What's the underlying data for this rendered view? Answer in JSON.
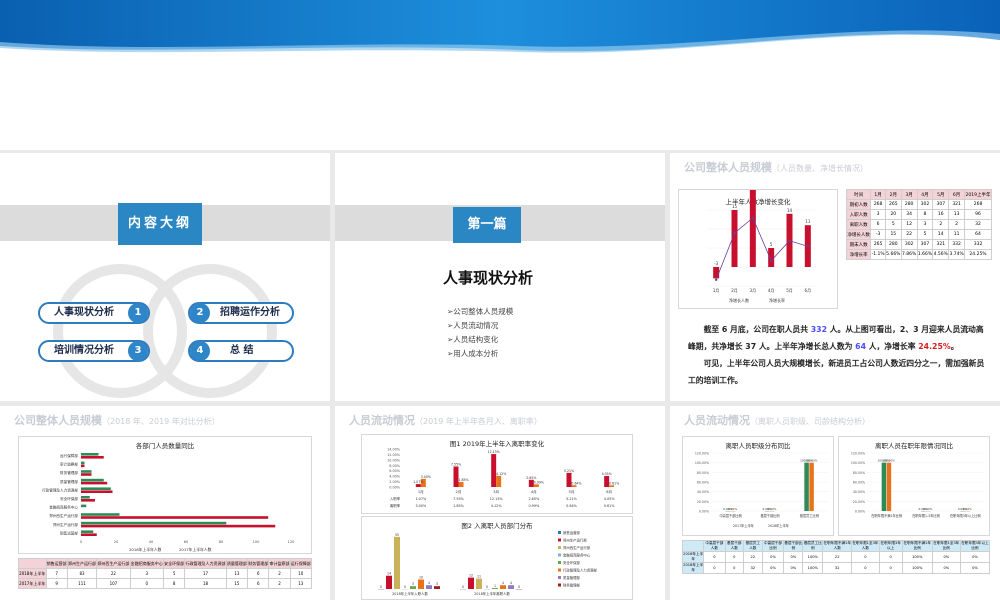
{
  "slide1": {
    "header": "内容大纲",
    "items": [
      {
        "label": "人事现状分析",
        "num": "1"
      },
      {
        "label": "招聘运作分析",
        "num": "2"
      },
      {
        "label": "培训情况分析",
        "num": "3"
      },
      {
        "label": "总  结",
        "num": "4"
      }
    ]
  },
  "slide2": {
    "tab": "第一篇",
    "title": "人事现状分析",
    "bullets": [
      "➢公司整体人员规模",
      "➢人员流动情况",
      "➢人员结构变化",
      "➢用人成本分析"
    ]
  },
  "slide3": {
    "title": "公司整体人员规模",
    "subtitle": "（人员数量、净增长情况）",
    "chart_title": "上半年人数净增长变化",
    "legend": [
      "净增长人数",
      "净增长率"
    ],
    "months": [
      "1月",
      "2月",
      "3月",
      "4月",
      "5月",
      "6月"
    ],
    "table_header": [
      "时间",
      "1月",
      "2月",
      "3月",
      "4月",
      "5月",
      "6月",
      "2019上半年"
    ],
    "table_rows": [
      [
        "期初人数",
        "268",
        "265",
        "280",
        "302",
        "307",
        "321",
        "268"
      ],
      [
        "入职人数",
        "3",
        "20",
        "34",
        "8",
        "16",
        "13",
        "96"
      ],
      [
        "离职人数",
        "6",
        "5",
        "12",
        "3",
        "2",
        "2",
        "32"
      ],
      [
        "净增长人数",
        "-3",
        "15",
        "22",
        "5",
        "14",
        "11",
        "64"
      ],
      [
        "期末人数",
        "265",
        "280",
        "302",
        "307",
        "321",
        "332",
        "332"
      ],
      [
        "净增长率",
        "-1.1%",
        "5.66%",
        "7.86%",
        "1.66%",
        "4.56%",
        "3.74%",
        "24.25%"
      ]
    ],
    "para1_a": "截至 6 月底，公司在职人员共 ",
    "para1_b": "332",
    "para1_c": " 人。从上图可看出，2、3 月迎来人员流动高峰期，共净增长 37 人。上半年净增长总人数为 ",
    "para1_d": "64",
    "para1_e": " 人，净增长率 ",
    "para1_f": "24.25%",
    "para1_g": "。",
    "para2": "可见，上半年公司人员大规模增长，新进员工占公司人数近四分之一，需加强新员工的培训工作。"
  },
  "slide4": {
    "title": "公司整体人员规模",
    "subtitle": "（2018 年、2019 年对比分析）",
    "chart_title": "各部门人员数量同比",
    "legend": [
      "2018年上半年人数",
      "2017年上半年人数"
    ],
    "depts": [
      "运行保障部",
      "审计监察部",
      "财务管理部",
      "质量管理部",
      "行政管理及人力资源部",
      "安全环保部",
      "金融招商服务中心",
      "郑州西生产运行部",
      "郑州生产运行部",
      "销售运营部"
    ],
    "table_header": [
      "",
      "销售运营部",
      "郑州生产运行部",
      "郑州西生产运行部",
      "金融招商服务中心",
      "安全环保部",
      "行政管理及人力资源部",
      "质量管理部",
      "财务管理部",
      "审计监察部",
      "运行保障部"
    ],
    "table_rows": [
      [
        "2018年上半年",
        "7",
        "83",
        "22",
        "3",
        "5",
        "17",
        "13",
        "6",
        "2",
        "10"
      ],
      [
        "2017年上半年",
        "9",
        "111",
        "107",
        "0",
        "8",
        "18",
        "15",
        "6",
        "2",
        "13"
      ]
    ]
  },
  "slide5": {
    "title": "人员流动情况",
    "subtitle": "（2019 年上半年各月入、离职率）",
    "chart1_title": "图1 2019年上半年入离职率变化",
    "months": [
      "1月",
      "2月",
      "3月",
      "4月",
      "5月",
      "6月"
    ],
    "row_in": [
      "1.07%",
      "7.55%",
      "12.13%",
      "2.65%",
      "5.21%",
      "4.05%"
    ],
    "row_out": [
      "3.00%",
      "1.85%",
      "4.12%",
      "0.99%",
      "0.64%",
      "0.61%"
    ],
    "row_in_label": "入职率",
    "row_out_label": "离职率",
    "chart2_title": "图2 入离职人员部门分布",
    "legend2": [
      "销售运营部",
      "郑州生产运行部",
      "郑州西生产运行部",
      "金融招商服务中心",
      "安全环保部",
      "行政管理及人力资源部",
      "质量管理部",
      "财务管理部"
    ],
    "x2": [
      "2018年上半年入职人数",
      "2018年上半年离职人数"
    ]
  },
  "slide6": {
    "title": "人员流动情况",
    "subtitle": "（离职人员职级、司龄结构分析）",
    "chart1_title": "离职人员职级分布同比",
    "chart2_title": "离职人员在职年限情况同比",
    "legend1": [
      "2017年上半年",
      "2018年上半年"
    ],
    "x1": [
      "中高层干部比例",
      "基层干部比例",
      "基层员工比例"
    ],
    "x2": [
      "在职年限不满1年比例",
      "在职年限1-3年比例",
      "在职年限3年以上比例"
    ],
    "table_header": [
      "",
      "中高层干部人数",
      "基层干部人数",
      "基层员工人数",
      "中高层干部比例",
      "基层干部比例",
      "基层员工比例",
      "在职年限不满1年人数",
      "在职年限1至3年人数",
      "在职年限3年以上",
      "在职年限不满1年比例",
      "在职年限1至3年比例",
      "在职年限3年以上比例"
    ],
    "table_rows": [
      [
        "2016年上半年",
        "0",
        "0",
        "22",
        "0%",
        "0%",
        "100%",
        "22",
        "0",
        "0",
        "100%",
        "0%",
        "0%"
      ],
      [
        "2018年上半年",
        "0",
        "0",
        "32",
        "0%",
        "0%",
        "100%",
        "32",
        "0",
        "0",
        "100%",
        "0%",
        "0%"
      ]
    ]
  },
  "colors": {
    "accent": "#2b86c4",
    "bar_red": "#c8102e",
    "bar_orange": "#e8731a",
    "bar_green": "#2e8b57",
    "line_purple": "#6a3d9a"
  }
}
